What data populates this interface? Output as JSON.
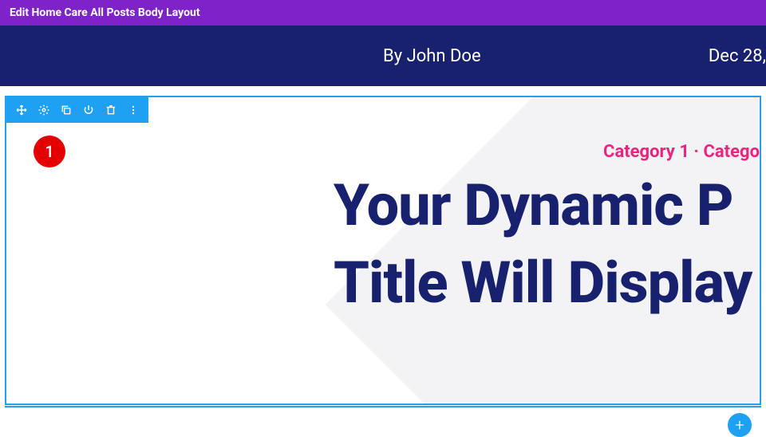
{
  "topbar": {
    "title": "Edit Home Care All Posts Body Layout"
  },
  "meta": {
    "author": "By John Doe",
    "date": "Dec 28,"
  },
  "badge": {
    "number": "1"
  },
  "categories": "Category 1 · Catego",
  "title_line1": "Your Dynamic P",
  "title_line2": "Title Will Display",
  "toolbar": {
    "move": "move",
    "settings": "settings",
    "duplicate": "duplicate",
    "power": "power",
    "delete": "delete",
    "more": "more"
  },
  "add": "+"
}
